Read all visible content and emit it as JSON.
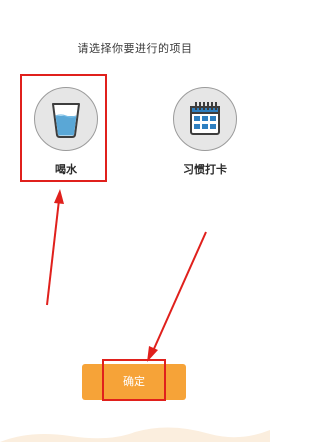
{
  "prompt": "请选择你要进行的项目",
  "options": [
    {
      "label": "喝水",
      "icon": "water-glass-icon",
      "selected": true
    },
    {
      "label": "习惯打卡",
      "icon": "calendar-icon",
      "selected": false
    }
  ],
  "confirm_label": "确定",
  "colors": {
    "accent": "#f6a338",
    "annotation": "#e0201c",
    "water": "#5aa7d6",
    "calendar": "#2d7fc1"
  }
}
